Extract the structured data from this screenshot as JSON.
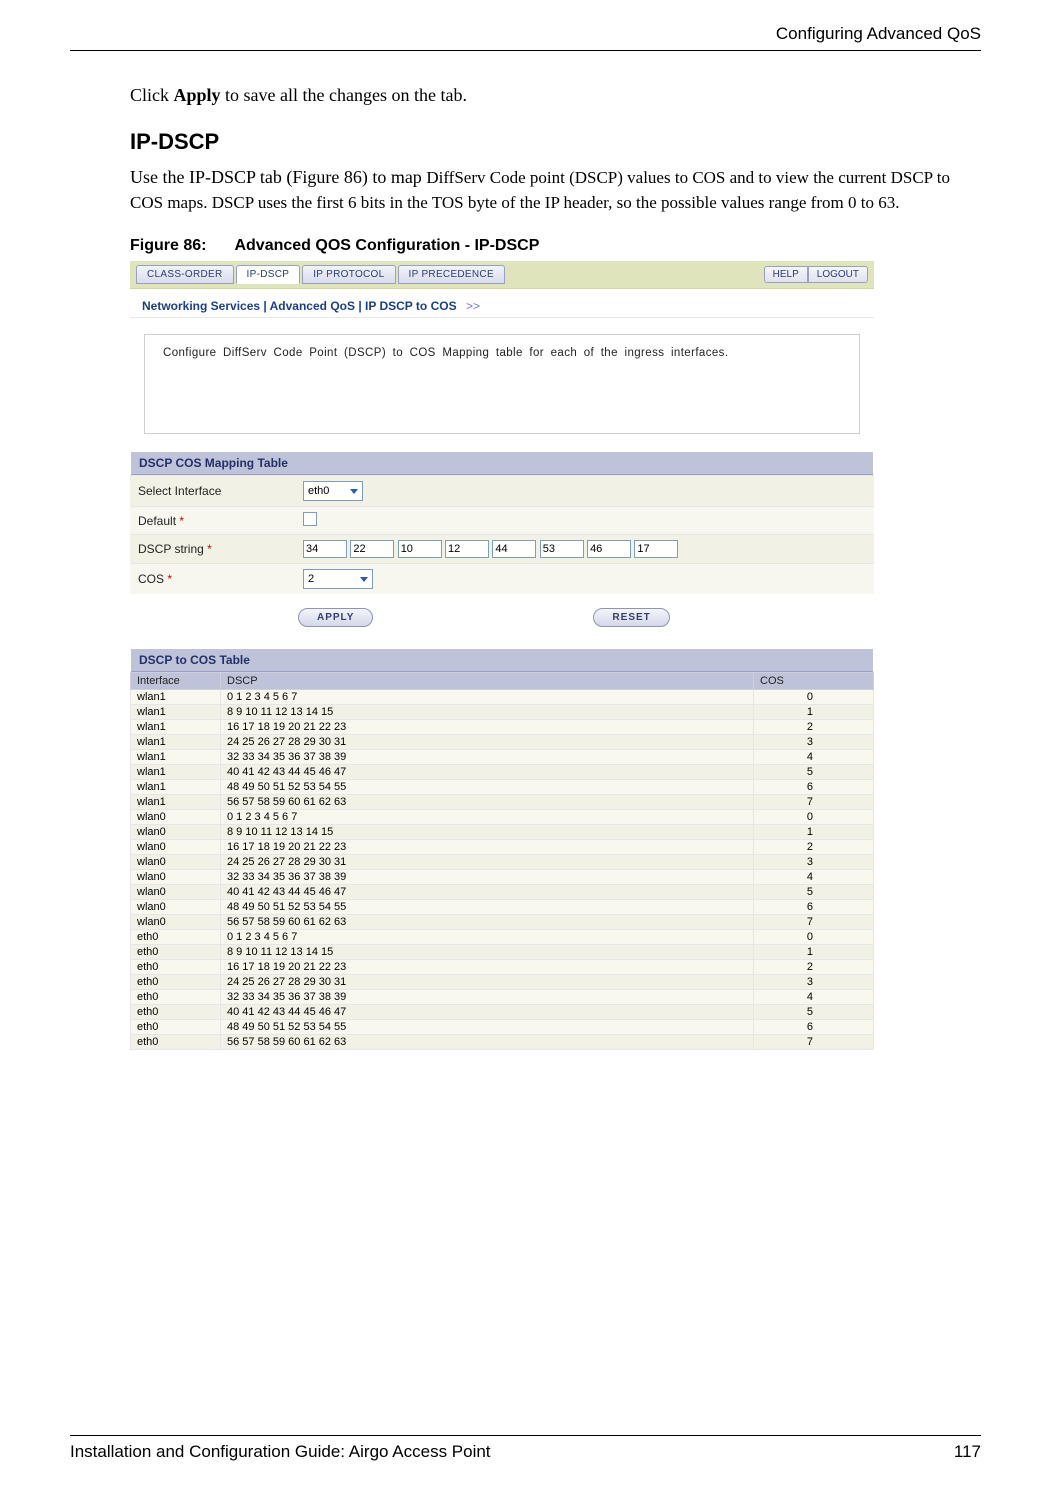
{
  "header": {
    "running": "Configuring Advanced QoS"
  },
  "intro_before_apply": "Click ",
  "intro_apply": "Apply",
  "intro_after_apply": " to save all the changes on the tab.",
  "section_title": "IP-DSCP",
  "section_body_1": "Use the IP-DSCP tab (Figure 86) to map ",
  "section_body_small": "DiffServ Code point (DSCP) values to COS and to view the current DSCP to COS maps. DSCP uses the first 6 bits in the TOS byte of the IP header, so the possible values range from 0 to 63.",
  "figure": {
    "num": "Figure 86:",
    "title": "Advanced QOS Configuration - IP-DSCP"
  },
  "ui": {
    "tabs": {
      "t0": "CLASS-ORDER",
      "t1": "IP-DSCP",
      "t2": "IP PROTOCOL",
      "t3": "IP PRECEDENCE"
    },
    "help": "HELP",
    "logout": "LOGOUT",
    "breadcrumb": "Networking Services | Advanced QoS | IP DSCP to COS",
    "breadcrumb_arrows": ">>",
    "info": "Configure DiffServ Code Point (DSCP) to COS Mapping table for each of the ingress interfaces.",
    "mapping_header": "DSCP COS Mapping Table",
    "labels": {
      "select_interface": "Select Interface",
      "default": "Default ",
      "dscp_string": "DSCP string ",
      "cos": "COS "
    },
    "star": "*",
    "select_interface_value": "eth0",
    "dscp_values": {
      "v0": "34",
      "v1": "22",
      "v2": "10",
      "v3": "12",
      "v4": "44",
      "v5": "53",
      "v6": "46",
      "v7": "17"
    },
    "cos_value": "2",
    "apply": "APPLY",
    "reset": "RESET",
    "table2_header": "DSCP to COS Table",
    "table2_cols": {
      "c0": "Interface",
      "c1": "DSCP",
      "c2": "COS"
    },
    "rows": [
      {
        "if": "wlan1",
        "dscp": "0 1 2 3 4 5 6 7",
        "cos": "0"
      },
      {
        "if": "wlan1",
        "dscp": "8 9 10 11 12 13 14 15",
        "cos": "1"
      },
      {
        "if": "wlan1",
        "dscp": "16 17 18 19 20 21 22 23",
        "cos": "2"
      },
      {
        "if": "wlan1",
        "dscp": "24 25 26 27 28 29 30 31",
        "cos": "3"
      },
      {
        "if": "wlan1",
        "dscp": "32 33 34 35 36 37 38 39",
        "cos": "4"
      },
      {
        "if": "wlan1",
        "dscp": "40 41 42 43 44 45 46 47",
        "cos": "5"
      },
      {
        "if": "wlan1",
        "dscp": "48 49 50 51 52 53 54 55",
        "cos": "6"
      },
      {
        "if": "wlan1",
        "dscp": "56 57 58 59 60 61 62 63",
        "cos": "7"
      },
      {
        "if": "wlan0",
        "dscp": "0 1 2 3 4 5 6 7",
        "cos": "0"
      },
      {
        "if": "wlan0",
        "dscp": "8 9 10 11 12 13 14 15",
        "cos": "1"
      },
      {
        "if": "wlan0",
        "dscp": "16 17 18 19 20 21 22 23",
        "cos": "2"
      },
      {
        "if": "wlan0",
        "dscp": "24 25 26 27 28 29 30 31",
        "cos": "3"
      },
      {
        "if": "wlan0",
        "dscp": "32 33 34 35 36 37 38 39",
        "cos": "4"
      },
      {
        "if": "wlan0",
        "dscp": "40 41 42 43 44 45 46 47",
        "cos": "5"
      },
      {
        "if": "wlan0",
        "dscp": "48 49 50 51 52 53 54 55",
        "cos": "6"
      },
      {
        "if": "wlan0",
        "dscp": "56 57 58 59 60 61 62 63",
        "cos": "7"
      },
      {
        "if": "eth0",
        "dscp": "0 1 2 3 4 5 6 7",
        "cos": "0"
      },
      {
        "if": "eth0",
        "dscp": "8 9 10 11 12 13 14 15",
        "cos": "1"
      },
      {
        "if": "eth0",
        "dscp": "16 17 18 19 20 21 22 23",
        "cos": "2"
      },
      {
        "if": "eth0",
        "dscp": "24 25 26 27 28 29 30 31",
        "cos": "3"
      },
      {
        "if": "eth0",
        "dscp": "32 33 34 35 36 37 38 39",
        "cos": "4"
      },
      {
        "if": "eth0",
        "dscp": "40 41 42 43 44 45 46 47",
        "cos": "5"
      },
      {
        "if": "eth0",
        "dscp": "48 49 50 51 52 53 54 55",
        "cos": "6"
      },
      {
        "if": "eth0",
        "dscp": "56 57 58 59 60 61 62 63",
        "cos": "7"
      }
    ]
  },
  "footer": {
    "left": "Installation and Configuration Guide: Airgo Access Point",
    "right": "117"
  }
}
